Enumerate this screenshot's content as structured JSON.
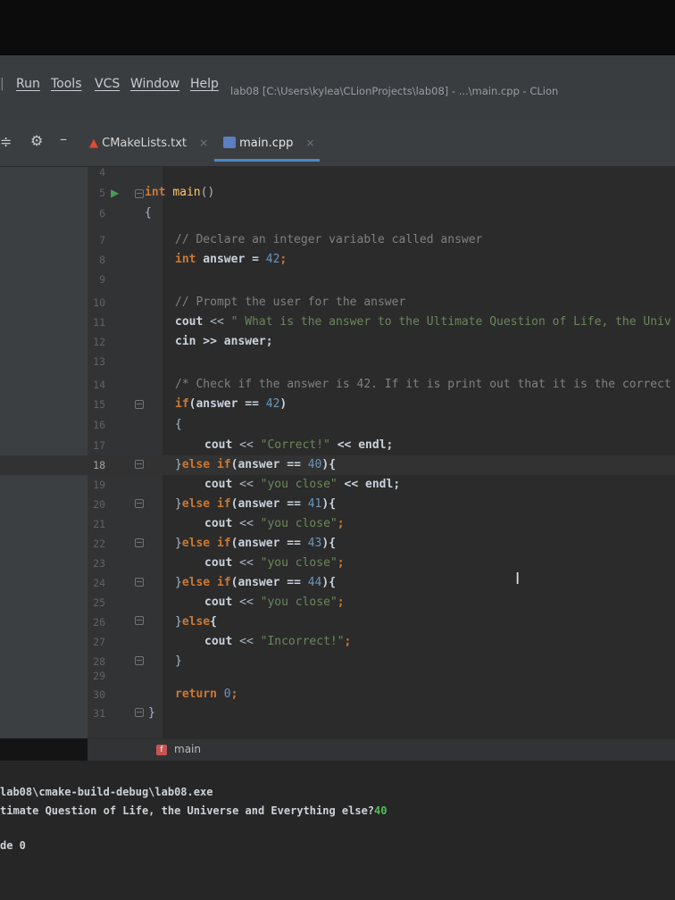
{
  "menubar": {
    "items": [
      "Run",
      "Tools",
      "VCS",
      "Window",
      "Help"
    ],
    "window_title": "lab08 [C:\\Users\\kylea\\CLionProjects\\lab08] - ...\\main.cpp - CLion"
  },
  "tabs": [
    {
      "label": "CMakeLists.txt",
      "icon": "cmake-triangle-icon",
      "active": false
    },
    {
      "label": "main.cpp",
      "icon": "cpp-file-icon",
      "active": true
    }
  ],
  "editor": {
    "current_line": 18,
    "line_numbers": [
      "4",
      "5",
      "6",
      "7",
      "8",
      "9",
      "10",
      "11",
      "12",
      "13",
      "14",
      "15",
      "16",
      "17",
      "18",
      "19",
      "20",
      "21",
      "22",
      "23",
      "24",
      "25",
      "26",
      "27",
      "28",
      "29",
      "30",
      "31"
    ],
    "lines": {
      "l5": {
        "kw": "int",
        "fn": "main",
        "rest": "()"
      },
      "l6": "{",
      "l7": "// Declare an integer variable called answer",
      "l8": {
        "kw": "int",
        "rest": " answer = ",
        "num": "42",
        "end": ";"
      },
      "l10": "// Prompt the user for the answer",
      "l11": {
        "kw": "cout",
        "op": " << ",
        "str": "\" What is the answer to the Ultimate Question of Life, the Univ"
      },
      "l12": {
        "kw": "cin",
        "rest": " >> answer;"
      },
      "l14": "/* Check if the answer is 42. If it is print out that it is the correct",
      "l15": {
        "kw": "if",
        "rest": "(answer == ",
        "num": "42",
        "end": ")"
      },
      "l16": "{",
      "l17": {
        "kw": "cout",
        "op": " << ",
        "str": "\"Correct!\"",
        "end": " << endl;"
      },
      "l18": {
        "pre": "}",
        "kw": "else if",
        "rest": "(answer == ",
        "num": "40",
        "end": "){"
      },
      "l19": {
        "kw": "cout",
        "op": " << ",
        "str": "\"you close\"",
        "end": " << endl;"
      },
      "l20": {
        "pre": "}",
        "kw": "else if",
        "rest": "(answer == ",
        "num": "41",
        "end": "){"
      },
      "l21": {
        "kw": "cout",
        "op": " << ",
        "str": "\"you close\"",
        "end": ";"
      },
      "l22": {
        "pre": "}",
        "kw": "else if",
        "rest": "(answer == ",
        "num": "43",
        "end": "){"
      },
      "l23": {
        "kw": "cout",
        "op": " << ",
        "str": "\"you close\"",
        "end": ";"
      },
      "l24": {
        "pre": "}",
        "kw": "else if",
        "rest": "(answer == ",
        "num": "44",
        "end": "){"
      },
      "l25": {
        "kw": "cout",
        "op": " << ",
        "str": "\"you close\"",
        "end": ";"
      },
      "l26": {
        "pre": "}",
        "kw": "else",
        "end": "{"
      },
      "l27": {
        "kw": "cout",
        "op": " << ",
        "str": "\"Incorrect!\"",
        "end": ";"
      },
      "l28": "}",
      "l30": {
        "kw": "return",
        "num": "0",
        "end": ";"
      },
      "l31": "}"
    }
  },
  "breadcrumb": {
    "icon": "f",
    "label": "main"
  },
  "console": {
    "line1": "lab08\\cmake-build-debug\\lab08.exe",
    "line2": "timate Question of Life, the Universe and Everything else?",
    "input": "40",
    "line3": "de 0"
  }
}
